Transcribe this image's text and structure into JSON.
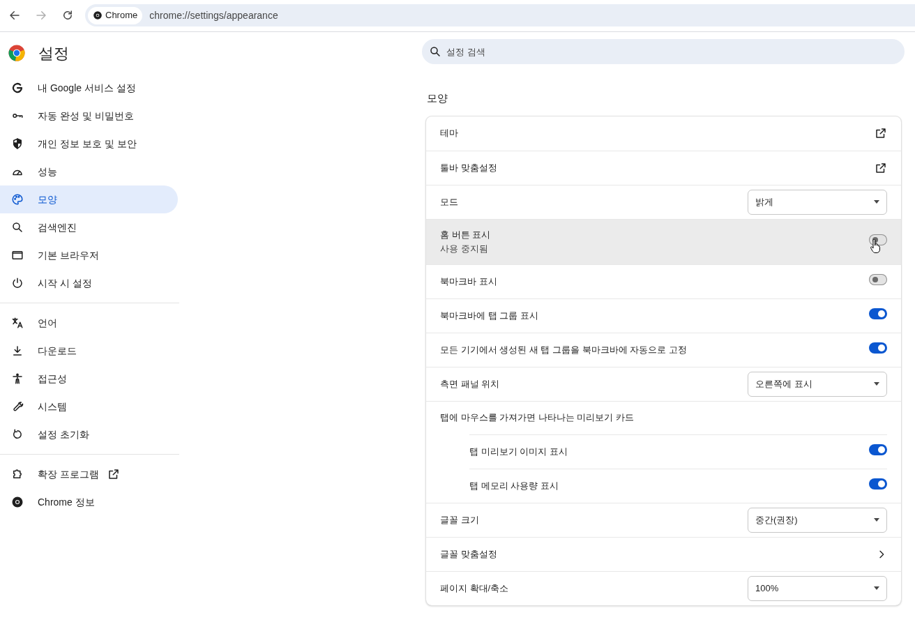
{
  "browser": {
    "nav_buttons": [
      {
        "kind": "back",
        "disabled": false
      },
      {
        "kind": "forward",
        "disabled": true
      },
      {
        "kind": "reload",
        "disabled": false
      }
    ],
    "site_chip": "Chrome",
    "url": "chrome://settings/appearance"
  },
  "header": {
    "title": "설정",
    "search": {
      "placeholder": "설정 검색"
    }
  },
  "sidebar": {
    "groups": [
      [
        {
          "label": "내 Google 서비스 설정",
          "selected": false
        },
        {
          "label": "자동 완성 및 비밀번호",
          "selected": false
        },
        {
          "label": "개인 정보 보호 및 보안",
          "selected": false
        },
        {
          "label": "성능",
          "selected": false
        },
        {
          "label": "모양",
          "selected": true
        },
        {
          "label": "검색엔진",
          "selected": false
        },
        {
          "label": "기본 브라우저",
          "selected": false
        },
        {
          "label": "시작 시 설정",
          "selected": false
        }
      ],
      [
        {
          "label": "언어",
          "selected": false
        },
        {
          "label": "다운로드",
          "selected": false
        },
        {
          "label": "접근성",
          "selected": false
        },
        {
          "label": "시스템",
          "selected": false
        },
        {
          "label": "설정 초기화",
          "selected": false
        }
      ],
      [
        {
          "label": "확장 프로그램",
          "selected": false,
          "external": true
        },
        {
          "label": "Chrome 정보",
          "selected": false
        }
      ]
    ]
  },
  "section": {
    "title": "모양",
    "rows": [
      {
        "kind": "link",
        "label": "테마"
      },
      {
        "kind": "link",
        "label": "툴바 맞춤설정"
      },
      {
        "kind": "select",
        "label": "모드",
        "value": "밝게"
      },
      {
        "kind": "toggle",
        "label": "홈 버튼 표시",
        "sublabel": "사용 중지됨",
        "on": false,
        "hovered": true
      },
      {
        "kind": "toggle",
        "label": "북마크바 표시",
        "on": false
      },
      {
        "kind": "toggle",
        "label": "북마크바에 탭 그룹 표시",
        "on": true
      },
      {
        "kind": "toggle",
        "label": "모든 기기에서 생성된 새 탭 그룹을 북마크바에 자동으로 고정",
        "on": true
      },
      {
        "kind": "select",
        "label": "측면 패널 위치",
        "value": "오른쪽에 표시"
      },
      {
        "kind": "heading",
        "label": "탭에 마우스를 가져가면 나타나는 미리보기 카드"
      },
      {
        "kind": "subtoggle",
        "label": "탭 미리보기 이미지 표시",
        "on": true
      },
      {
        "kind": "subtoggle",
        "label": "탭 메모리 사용량 표시",
        "on": true
      },
      {
        "kind": "select",
        "label": "글꼴 크기",
        "value": "중간(권장)"
      },
      {
        "kind": "arrow",
        "label": "글꼴 맞춤설정"
      },
      {
        "kind": "select",
        "label": "페이지 확대/축소",
        "value": "100%"
      }
    ]
  }
}
